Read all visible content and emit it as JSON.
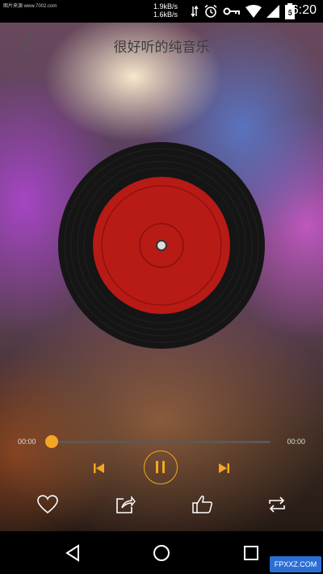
{
  "status_bar": {
    "left_text": "图片来源 www.7002.com",
    "speed_up": "1.9kB/s",
    "speed_down": "1.6kB/s",
    "time": "16:20",
    "battery_level": "6"
  },
  "header": {
    "title": "很好听的纯音乐"
  },
  "player": {
    "current_time": "00:00",
    "total_time": "00:00",
    "progress": 0,
    "accent_color": "#f5a623",
    "disc_label_color": "#b81a16"
  },
  "actions": [
    "heart-icon",
    "share-icon",
    "thumbs-up-icon",
    "repeat-icon"
  ],
  "nav": [
    "back-triangle-icon",
    "home-circle-icon",
    "recents-square-icon"
  ],
  "watermark": "FPXXZ.COM"
}
